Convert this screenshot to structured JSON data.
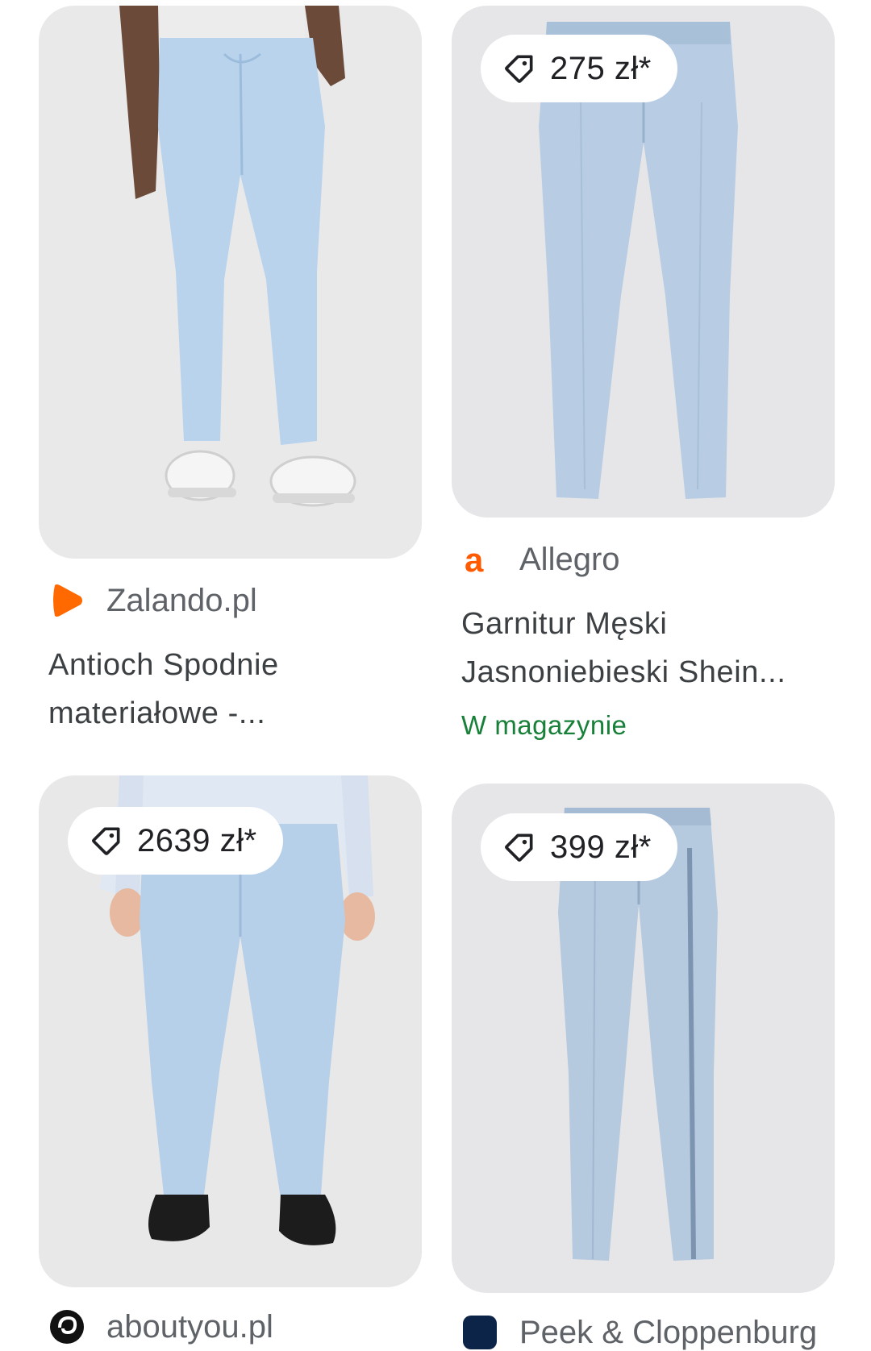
{
  "products": [
    {
      "image_alt": "light blue trousers with drawstring and white sneakers",
      "price": "",
      "source_icon": "zalando-logo-icon",
      "source": "Zalando.pl",
      "title_line1": "Antioch Spodnie",
      "title_line2": "materiałowe -...",
      "stock": ""
    },
    {
      "image_alt": "light blue suit trousers",
      "price": "275 zł*",
      "source_icon": "allegro-logo-icon",
      "source": "Allegro",
      "title_line1": "Garnitur Męski",
      "title_line2": "Jasnoniebieski Shein...",
      "stock": "W magazynie"
    },
    {
      "image_alt": "light blue suit trousers with white shirt and black shoes",
      "price": "2639 zł*",
      "source_icon": "aboutyou-logo-icon",
      "source": "aboutyou.pl",
      "title_line1": "",
      "title_line2": "",
      "stock": ""
    },
    {
      "image_alt": "light blue pressed trousers",
      "price": "399 zł*",
      "source_icon": "store-logo-icon",
      "source": "Peek & Cloppenburg",
      "title_line1": "",
      "title_line2": "",
      "stock": ""
    }
  ],
  "colors": {
    "card_bg": "#e6e6e8",
    "trouser": "#b9d3ec",
    "stock_green": "#188038",
    "zalando_orange": "#ff6900",
    "allegro_orange": "#ff5a00"
  }
}
